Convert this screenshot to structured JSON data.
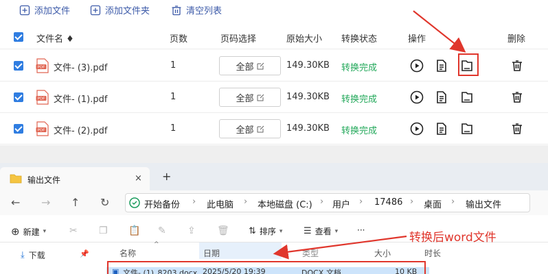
{
  "toolbar": {
    "add_file": "添加文件",
    "add_folder": "添加文件夹",
    "clear_list": "清空列表"
  },
  "table": {
    "headers": {
      "filename": "文件名 ♦",
      "pages": "页数",
      "page_select": "页码选择",
      "orig_size": "原始大小",
      "status": "转换状态",
      "actions": "操作",
      "delete": "删除"
    },
    "rows": [
      {
        "name": "文件- (3).pdf",
        "pages": "1",
        "range": "全部",
        "size": "149.30KB",
        "status": "转换完成"
      },
      {
        "name": "文件- (1).pdf",
        "pages": "1",
        "range": "全部",
        "size": "149.30KB",
        "status": "转换完成"
      },
      {
        "name": "文件- (2).pdf",
        "pages": "1",
        "range": "全部",
        "size": "149.30KB",
        "status": "转换完成"
      }
    ]
  },
  "explorer": {
    "tab_title": "输出文件",
    "tab_close": "×",
    "new_tab": "+",
    "breadcrumb": [
      "开始备份",
      "此电脑",
      "本地磁盘 (C:)",
      "用户",
      "17486",
      "桌面",
      "输出文件"
    ],
    "cmd": {
      "new": "新建",
      "sort": "排序",
      "view": "查看",
      "more": "···"
    },
    "tree": {
      "downloads": "下载"
    },
    "columns": {
      "name": "名称",
      "date": "日期",
      "type": "类型",
      "size": "大小",
      "duration": "时长"
    },
    "file": {
      "name": "文件- (1)_8203.docx",
      "date": "2025/5/20 19:39",
      "type": "DOCX 文档",
      "size": "10 KB"
    }
  },
  "annotation": {
    "text": "转换后word文件",
    "color": "#e0362c"
  },
  "colors": {
    "accent": "#2f7de1",
    "status": "#22a85a",
    "toolbar_text": "#3d5ba9"
  },
  "icons": [
    "add-file-icon",
    "add-folder-icon",
    "clear-list-icon",
    "pdf-icon",
    "play-icon",
    "document-icon",
    "open-folder-icon",
    "trash-icon",
    "folder-icon",
    "back-icon",
    "forward-icon",
    "up-icon",
    "refresh-icon",
    "backup-icon",
    "new-icon",
    "cut-icon",
    "copy-icon",
    "paste-icon",
    "rename-icon",
    "share-icon",
    "delete-icon",
    "sort-icon",
    "view-icon",
    "download-icon",
    "pin-icon",
    "word-file-icon"
  ]
}
